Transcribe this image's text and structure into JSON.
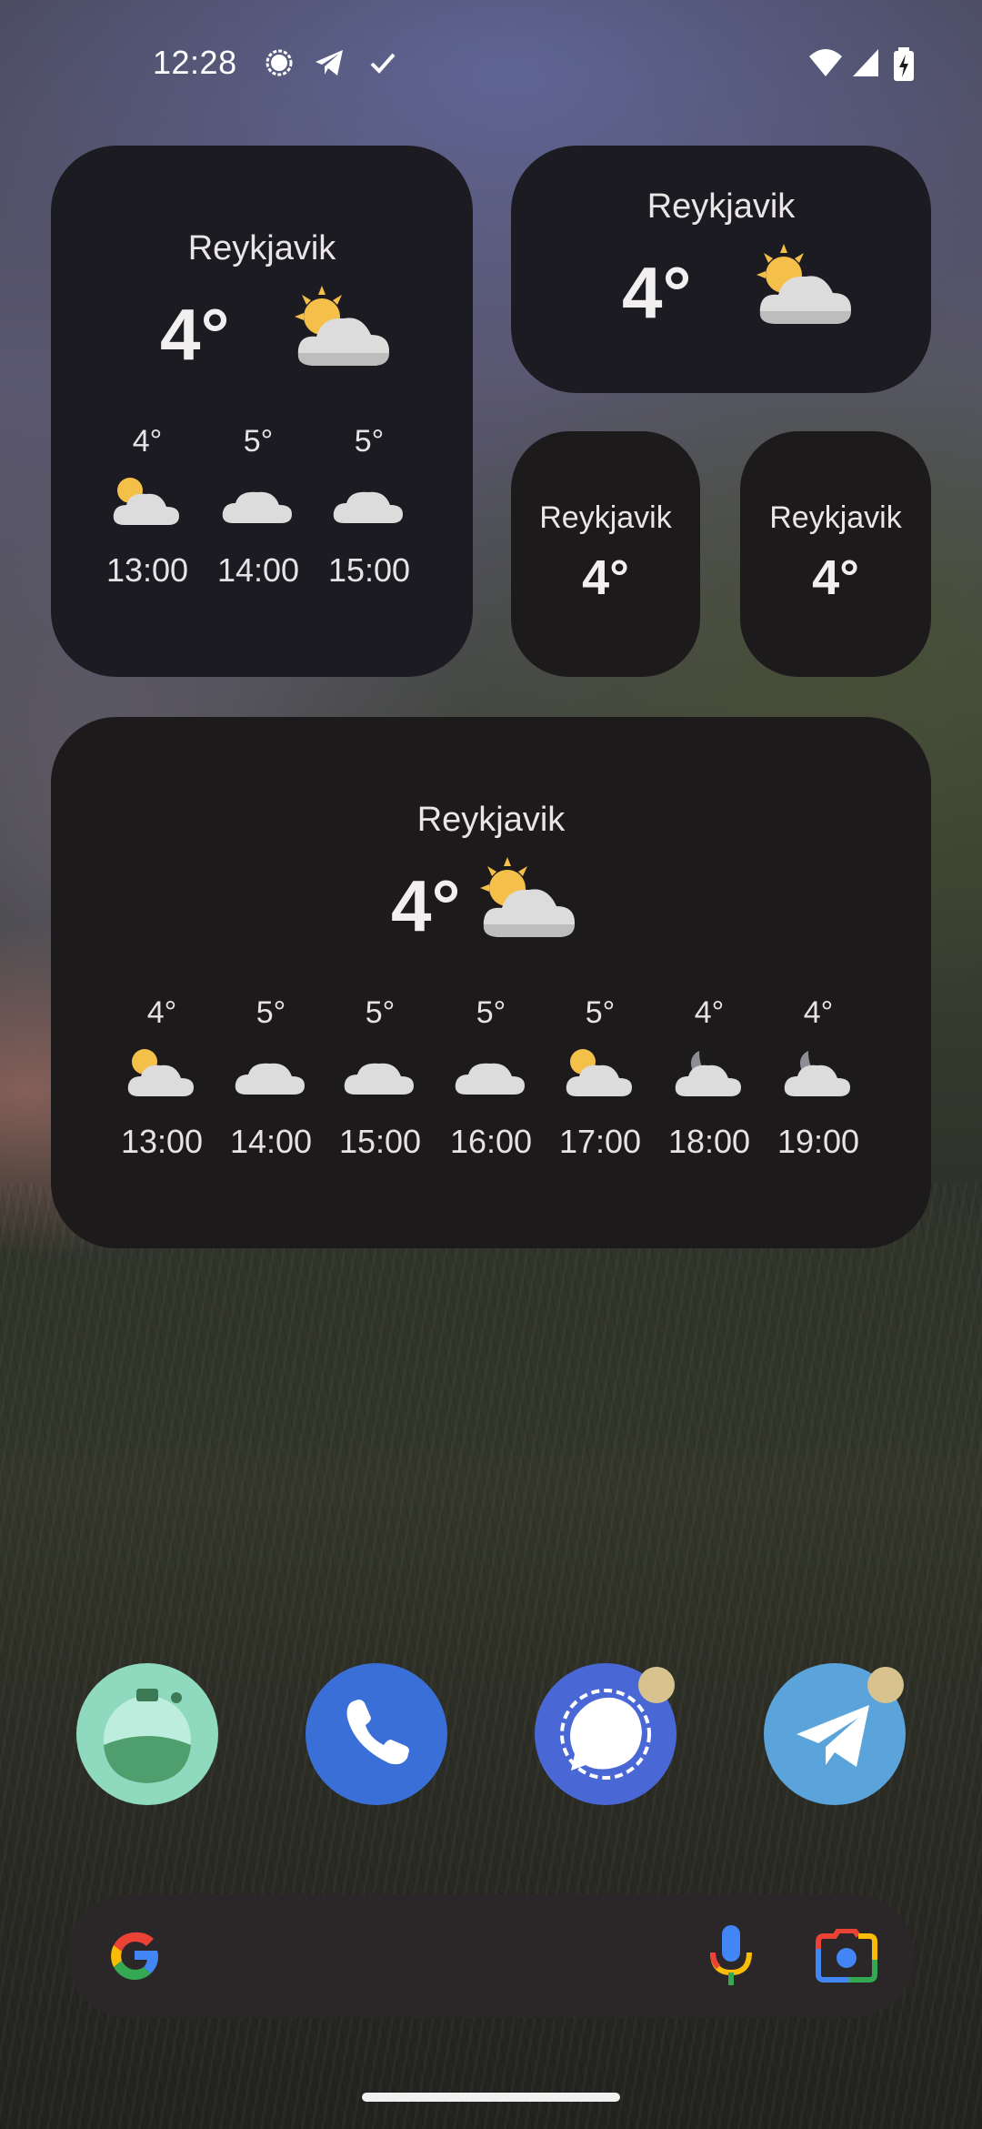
{
  "status_bar": {
    "time": "12:28",
    "notification_icons": [
      "signal-app-icon",
      "telegram-icon",
      "check-icon"
    ],
    "system_icons": [
      "wifi-icon",
      "cell-signal-icon",
      "battery-charging-icon"
    ]
  },
  "widgets": {
    "medium": {
      "city": "Reykjavik",
      "temp": "4°",
      "condition_icon": "partly-cloudy-icon",
      "hours": [
        {
          "temp": "4°",
          "icon": "partly-cloudy-icon",
          "time": "13:00"
        },
        {
          "temp": "5°",
          "icon": "cloudy-icon",
          "time": "14:00"
        },
        {
          "temp": "5°",
          "icon": "cloudy-icon",
          "time": "15:00"
        }
      ]
    },
    "wide_small": {
      "city": "Reykjavik",
      "temp": "4°",
      "condition_icon": "partly-cloudy-icon"
    },
    "tiny_1": {
      "city": "Reykjavik",
      "temp": "4°"
    },
    "tiny_2": {
      "city": "Reykjavik",
      "temp": "4°"
    },
    "large": {
      "city": "Reykjavik",
      "temp": "4°",
      "condition_icon": "partly-cloudy-icon",
      "hours": [
        {
          "temp": "4°",
          "icon": "partly-cloudy-icon",
          "time": "13:00"
        },
        {
          "temp": "5°",
          "icon": "cloudy-icon",
          "time": "14:00"
        },
        {
          "temp": "5°",
          "icon": "cloudy-icon",
          "time": "15:00"
        },
        {
          "temp": "5°",
          "icon": "cloudy-icon",
          "time": "16:00"
        },
        {
          "temp": "5°",
          "icon": "partly-cloudy-icon",
          "time": "17:00"
        },
        {
          "temp": "4°",
          "icon": "night-cloudy-icon",
          "time": "18:00"
        },
        {
          "temp": "4°",
          "icon": "night-cloudy-icon",
          "time": "19:00"
        }
      ]
    }
  },
  "dock": {
    "apps": [
      {
        "name": "potion-app-icon",
        "color": "#8fd9bf",
        "badge": false
      },
      {
        "name": "phone-app-icon",
        "color": "#3b6fd8",
        "badge": false
      },
      {
        "name": "signal-app-icon",
        "color": "#4a67d6",
        "badge": true
      },
      {
        "name": "telegram-app-icon",
        "color": "#5aa3db",
        "badge": true
      }
    ]
  },
  "search_bar": {
    "left_icon": "google-g-icon",
    "right_icons": [
      "microphone-icon",
      "lens-camera-icon"
    ]
  },
  "colors": {
    "widget_bg": "#1c1b21",
    "badge": "#d8c38f",
    "search_bg": "#2b2628"
  }
}
